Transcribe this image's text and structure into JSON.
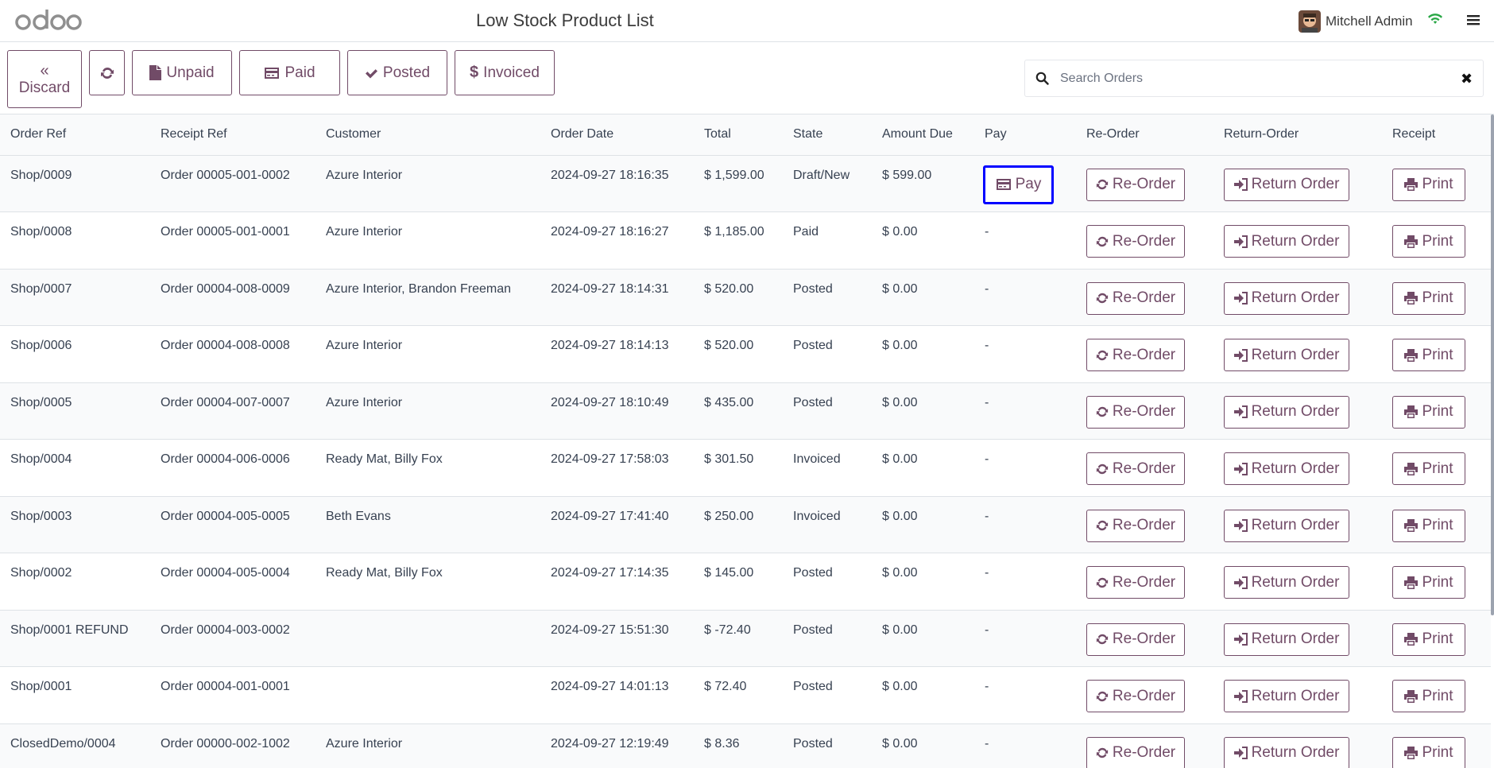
{
  "header": {
    "logo_text": "odoo",
    "title": "Low Stock Product List",
    "user_name": "Mitchell Admin"
  },
  "toolbar": {
    "discard_label": "Discard",
    "unpaid_label": "Unpaid",
    "paid_label": "Paid",
    "posted_label": "Posted",
    "invoiced_label": "Invoiced"
  },
  "search": {
    "placeholder": "Search Orders",
    "value": ""
  },
  "table": {
    "columns": [
      "Order Ref",
      "Receipt Ref",
      "Customer",
      "Order Date",
      "Total",
      "State",
      "Amount Due",
      "Pay",
      "Re-Order",
      "Return-Order",
      "Receipt"
    ],
    "pay_label": "Pay",
    "reorder_label": "Re-Order",
    "return_label": "Return Order",
    "print_label": "Print",
    "rows": [
      {
        "order_ref": "Shop/0009",
        "receipt_ref": "Order 00005-001-0002",
        "customer": "Azure Interior",
        "date": "2024-09-27 18:16:35",
        "total": "$ 1,599.00",
        "state": "Draft/New",
        "amount_due": "$ 599.00",
        "pay": "Pay"
      },
      {
        "order_ref": "Shop/0008",
        "receipt_ref": "Order 00005-001-0001",
        "customer": "Azure Interior",
        "date": "2024-09-27 18:16:27",
        "total": "$ 1,185.00",
        "state": "Paid",
        "amount_due": "$ 0.00",
        "pay": "-"
      },
      {
        "order_ref": "Shop/0007",
        "receipt_ref": "Order 00004-008-0009",
        "customer": "Azure Interior, Brandon Freeman",
        "date": "2024-09-27 18:14:31",
        "total": "$ 520.00",
        "state": "Posted",
        "amount_due": "$ 0.00",
        "pay": "-"
      },
      {
        "order_ref": "Shop/0006",
        "receipt_ref": "Order 00004-008-0008",
        "customer": "Azure Interior",
        "date": "2024-09-27 18:14:13",
        "total": "$ 520.00",
        "state": "Posted",
        "amount_due": "$ 0.00",
        "pay": "-"
      },
      {
        "order_ref": "Shop/0005",
        "receipt_ref": "Order 00004-007-0007",
        "customer": "Azure Interior",
        "date": "2024-09-27 18:10:49",
        "total": "$ 435.00",
        "state": "Posted",
        "amount_due": "$ 0.00",
        "pay": "-"
      },
      {
        "order_ref": "Shop/0004",
        "receipt_ref": "Order 00004-006-0006",
        "customer": "Ready Mat, Billy Fox",
        "date": "2024-09-27 17:58:03",
        "total": "$ 301.50",
        "state": "Invoiced",
        "amount_due": "$ 0.00",
        "pay": "-"
      },
      {
        "order_ref": "Shop/0003",
        "receipt_ref": "Order 00004-005-0005",
        "customer": "Beth Evans",
        "date": "2024-09-27 17:41:40",
        "total": "$ 250.00",
        "state": "Invoiced",
        "amount_due": "$ 0.00",
        "pay": "-"
      },
      {
        "order_ref": "Shop/0002",
        "receipt_ref": "Order 00004-005-0004",
        "customer": "Ready Mat, Billy Fox",
        "date": "2024-09-27 17:14:35",
        "total": "$ 145.00",
        "state": "Posted",
        "amount_due": "$ 0.00",
        "pay": "-"
      },
      {
        "order_ref": "Shop/0001 REFUND",
        "receipt_ref": "Order 00004-003-0002",
        "customer": "",
        "date": "2024-09-27 15:51:30",
        "total": "$ -72.40",
        "state": "Posted",
        "amount_due": "$ 0.00",
        "pay": "-"
      },
      {
        "order_ref": "Shop/0001",
        "receipt_ref": "Order 00004-001-0001",
        "customer": "",
        "date": "2024-09-27 14:01:13",
        "total": "$ 72.40",
        "state": "Posted",
        "amount_due": "$ 0.00",
        "pay": "-"
      },
      {
        "order_ref": "ClosedDemo/0004",
        "receipt_ref": "Order 00000-002-1002",
        "customer": "Azure Interior",
        "date": "2024-09-27 12:19:49",
        "total": "$ 8.36",
        "state": "Posted",
        "amount_due": "$ 0.00",
        "pay": "-"
      }
    ]
  },
  "colors": {
    "accent": "#714b67",
    "wifi": "#28a745",
    "focus_outline": "#0000ff"
  },
  "icons": {
    "discard": "double-chevron-left-icon",
    "refresh": "refresh-icon",
    "unpaid": "file-icon",
    "paid": "credit-card-icon",
    "posted": "check-icon",
    "invoiced": "dollar-icon",
    "search": "search-icon",
    "clear": "close-icon",
    "reorder": "refresh-icon",
    "return": "sign-in-icon",
    "print": "print-icon"
  }
}
